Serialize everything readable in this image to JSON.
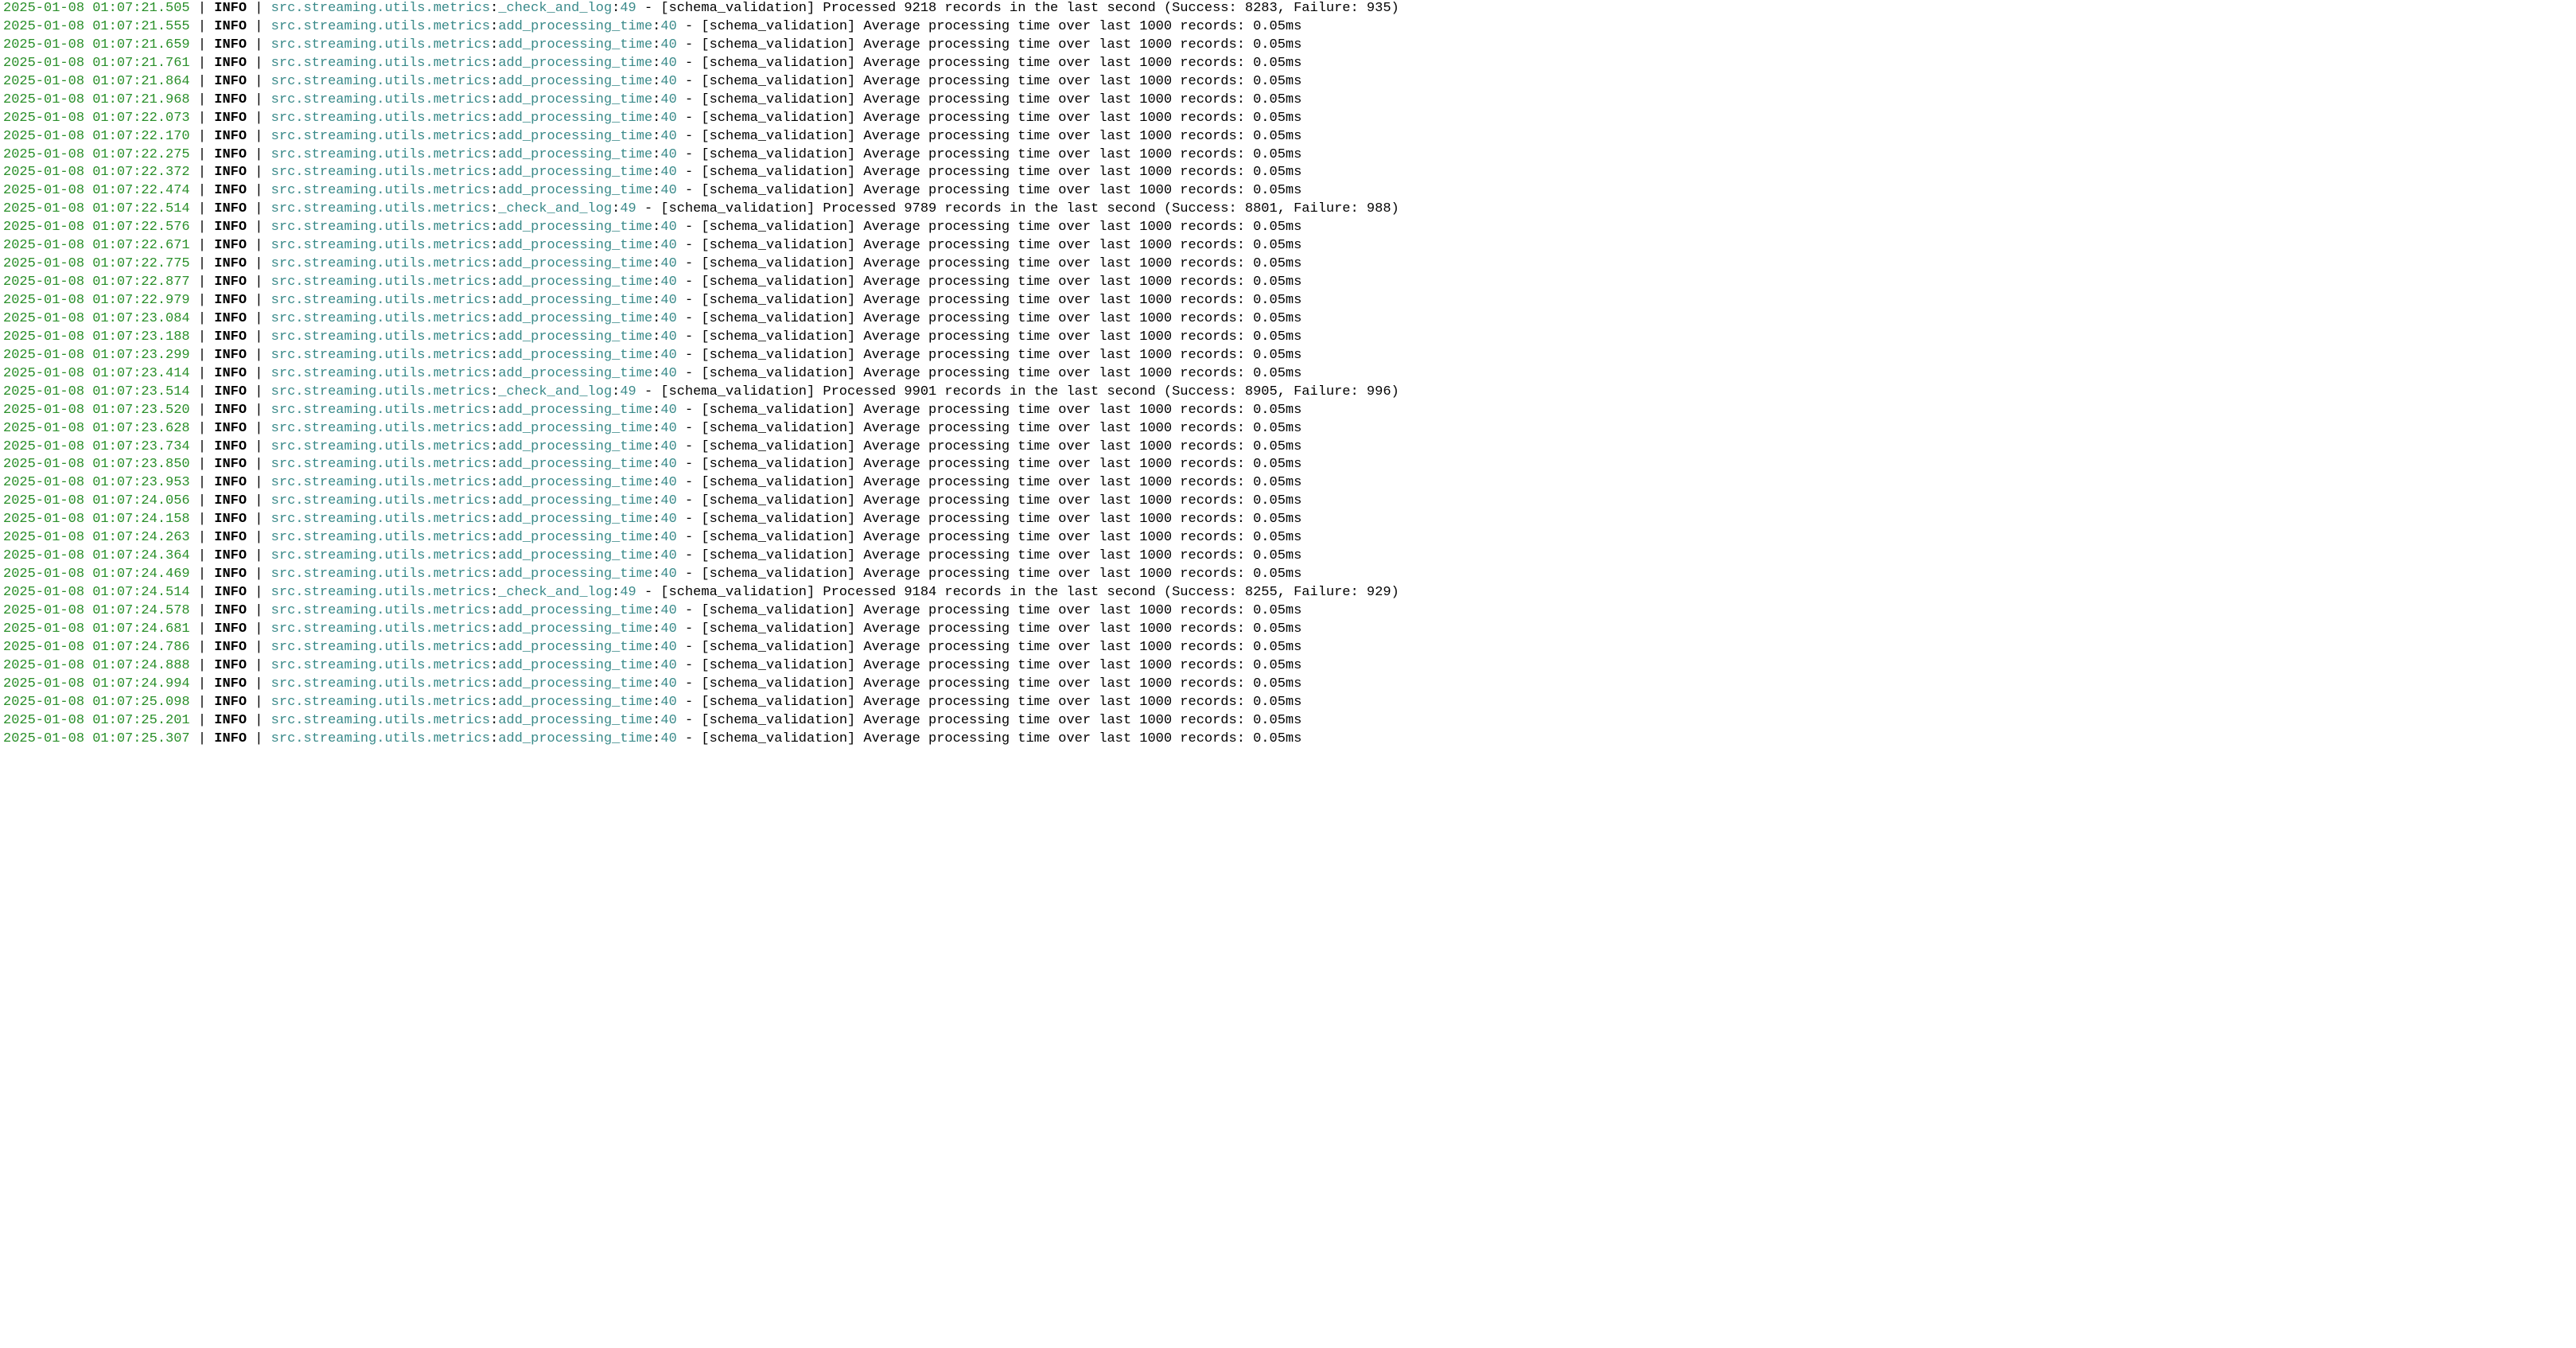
{
  "separator": " | ",
  "pipe": " | ",
  "level_pad": "    ",
  "module": "src.streaming.utils.metrics",
  "lines": [
    {
      "ts": "2025-01-08 01:07:21.505",
      "level": "INFO",
      "func": "_check_and_log",
      "lineno": "49",
      "msg": " - [schema_validation] Processed 9218 records in the last second (Success: 8283, Failure: 935)"
    },
    {
      "ts": "2025-01-08 01:07:21.555",
      "level": "INFO",
      "func": "add_processing_time",
      "lineno": "40",
      "msg": " - [schema_validation] Average processing time over last 1000 records: 0.05ms"
    },
    {
      "ts": "2025-01-08 01:07:21.659",
      "level": "INFO",
      "func": "add_processing_time",
      "lineno": "40",
      "msg": " - [schema_validation] Average processing time over last 1000 records: 0.05ms"
    },
    {
      "ts": "2025-01-08 01:07:21.761",
      "level": "INFO",
      "func": "add_processing_time",
      "lineno": "40",
      "msg": " - [schema_validation] Average processing time over last 1000 records: 0.05ms"
    },
    {
      "ts": "2025-01-08 01:07:21.864",
      "level": "INFO",
      "func": "add_processing_time",
      "lineno": "40",
      "msg": " - [schema_validation] Average processing time over last 1000 records: 0.05ms"
    },
    {
      "ts": "2025-01-08 01:07:21.968",
      "level": "INFO",
      "func": "add_processing_time",
      "lineno": "40",
      "msg": " - [schema_validation] Average processing time over last 1000 records: 0.05ms"
    },
    {
      "ts": "2025-01-08 01:07:22.073",
      "level": "INFO",
      "func": "add_processing_time",
      "lineno": "40",
      "msg": " - [schema_validation] Average processing time over last 1000 records: 0.05ms"
    },
    {
      "ts": "2025-01-08 01:07:22.170",
      "level": "INFO",
      "func": "add_processing_time",
      "lineno": "40",
      "msg": " - [schema_validation] Average processing time over last 1000 records: 0.05ms"
    },
    {
      "ts": "2025-01-08 01:07:22.275",
      "level": "INFO",
      "func": "add_processing_time",
      "lineno": "40",
      "msg": " - [schema_validation] Average processing time over last 1000 records: 0.05ms"
    },
    {
      "ts": "2025-01-08 01:07:22.372",
      "level": "INFO",
      "func": "add_processing_time",
      "lineno": "40",
      "msg": " - [schema_validation] Average processing time over last 1000 records: 0.05ms"
    },
    {
      "ts": "2025-01-08 01:07:22.474",
      "level": "INFO",
      "func": "add_processing_time",
      "lineno": "40",
      "msg": " - [schema_validation] Average processing time over last 1000 records: 0.05ms"
    },
    {
      "ts": "2025-01-08 01:07:22.514",
      "level": "INFO",
      "func": "_check_and_log",
      "lineno": "49",
      "msg": " - [schema_validation] Processed 9789 records in the last second (Success: 8801, Failure: 988)"
    },
    {
      "ts": "2025-01-08 01:07:22.576",
      "level": "INFO",
      "func": "add_processing_time",
      "lineno": "40",
      "msg": " - [schema_validation] Average processing time over last 1000 records: 0.05ms"
    },
    {
      "ts": "2025-01-08 01:07:22.671",
      "level": "INFO",
      "func": "add_processing_time",
      "lineno": "40",
      "msg": " - [schema_validation] Average processing time over last 1000 records: 0.05ms"
    },
    {
      "ts": "2025-01-08 01:07:22.775",
      "level": "INFO",
      "func": "add_processing_time",
      "lineno": "40",
      "msg": " - [schema_validation] Average processing time over last 1000 records: 0.05ms"
    },
    {
      "ts": "2025-01-08 01:07:22.877",
      "level": "INFO",
      "func": "add_processing_time",
      "lineno": "40",
      "msg": " - [schema_validation] Average processing time over last 1000 records: 0.05ms"
    },
    {
      "ts": "2025-01-08 01:07:22.979",
      "level": "INFO",
      "func": "add_processing_time",
      "lineno": "40",
      "msg": " - [schema_validation] Average processing time over last 1000 records: 0.05ms"
    },
    {
      "ts": "2025-01-08 01:07:23.084",
      "level": "INFO",
      "func": "add_processing_time",
      "lineno": "40",
      "msg": " - [schema_validation] Average processing time over last 1000 records: 0.05ms"
    },
    {
      "ts": "2025-01-08 01:07:23.188",
      "level": "INFO",
      "func": "add_processing_time",
      "lineno": "40",
      "msg": " - [schema_validation] Average processing time over last 1000 records: 0.05ms"
    },
    {
      "ts": "2025-01-08 01:07:23.299",
      "level": "INFO",
      "func": "add_processing_time",
      "lineno": "40",
      "msg": " - [schema_validation] Average processing time over last 1000 records: 0.05ms"
    },
    {
      "ts": "2025-01-08 01:07:23.414",
      "level": "INFO",
      "func": "add_processing_time",
      "lineno": "40",
      "msg": " - [schema_validation] Average processing time over last 1000 records: 0.05ms"
    },
    {
      "ts": "2025-01-08 01:07:23.514",
      "level": "INFO",
      "func": "_check_and_log",
      "lineno": "49",
      "msg": " - [schema_validation] Processed 9901 records in the last second (Success: 8905, Failure: 996)"
    },
    {
      "ts": "2025-01-08 01:07:23.520",
      "level": "INFO",
      "func": "add_processing_time",
      "lineno": "40",
      "msg": " - [schema_validation] Average processing time over last 1000 records: 0.05ms"
    },
    {
      "ts": "2025-01-08 01:07:23.628",
      "level": "INFO",
      "func": "add_processing_time",
      "lineno": "40",
      "msg": " - [schema_validation] Average processing time over last 1000 records: 0.05ms"
    },
    {
      "ts": "2025-01-08 01:07:23.734",
      "level": "INFO",
      "func": "add_processing_time",
      "lineno": "40",
      "msg": " - [schema_validation] Average processing time over last 1000 records: 0.05ms"
    },
    {
      "ts": "2025-01-08 01:07:23.850",
      "level": "INFO",
      "func": "add_processing_time",
      "lineno": "40",
      "msg": " - [schema_validation] Average processing time over last 1000 records: 0.05ms"
    },
    {
      "ts": "2025-01-08 01:07:23.953",
      "level": "INFO",
      "func": "add_processing_time",
      "lineno": "40",
      "msg": " - [schema_validation] Average processing time over last 1000 records: 0.05ms"
    },
    {
      "ts": "2025-01-08 01:07:24.056",
      "level": "INFO",
      "func": "add_processing_time",
      "lineno": "40",
      "msg": " - [schema_validation] Average processing time over last 1000 records: 0.05ms"
    },
    {
      "ts": "2025-01-08 01:07:24.158",
      "level": "INFO",
      "func": "add_processing_time",
      "lineno": "40",
      "msg": " - [schema_validation] Average processing time over last 1000 records: 0.05ms"
    },
    {
      "ts": "2025-01-08 01:07:24.263",
      "level": "INFO",
      "func": "add_processing_time",
      "lineno": "40",
      "msg": " - [schema_validation] Average processing time over last 1000 records: 0.05ms"
    },
    {
      "ts": "2025-01-08 01:07:24.364",
      "level": "INFO",
      "func": "add_processing_time",
      "lineno": "40",
      "msg": " - [schema_validation] Average processing time over last 1000 records: 0.05ms"
    },
    {
      "ts": "2025-01-08 01:07:24.469",
      "level": "INFO",
      "func": "add_processing_time",
      "lineno": "40",
      "msg": " - [schema_validation] Average processing time over last 1000 records: 0.05ms"
    },
    {
      "ts": "2025-01-08 01:07:24.514",
      "level": "INFO",
      "func": "_check_and_log",
      "lineno": "49",
      "msg": " - [schema_validation] Processed 9184 records in the last second (Success: 8255, Failure: 929)"
    },
    {
      "ts": "2025-01-08 01:07:24.578",
      "level": "INFO",
      "func": "add_processing_time",
      "lineno": "40",
      "msg": " - [schema_validation] Average processing time over last 1000 records: 0.05ms"
    },
    {
      "ts": "2025-01-08 01:07:24.681",
      "level": "INFO",
      "func": "add_processing_time",
      "lineno": "40",
      "msg": " - [schema_validation] Average processing time over last 1000 records: 0.05ms"
    },
    {
      "ts": "2025-01-08 01:07:24.786",
      "level": "INFO",
      "func": "add_processing_time",
      "lineno": "40",
      "msg": " - [schema_validation] Average processing time over last 1000 records: 0.05ms"
    },
    {
      "ts": "2025-01-08 01:07:24.888",
      "level": "INFO",
      "func": "add_processing_time",
      "lineno": "40",
      "msg": " - [schema_validation] Average processing time over last 1000 records: 0.05ms"
    },
    {
      "ts": "2025-01-08 01:07:24.994",
      "level": "INFO",
      "func": "add_processing_time",
      "lineno": "40",
      "msg": " - [schema_validation] Average processing time over last 1000 records: 0.05ms"
    },
    {
      "ts": "2025-01-08 01:07:25.098",
      "level": "INFO",
      "func": "add_processing_time",
      "lineno": "40",
      "msg": " - [schema_validation] Average processing time over last 1000 records: 0.05ms"
    },
    {
      "ts": "2025-01-08 01:07:25.201",
      "level": "INFO",
      "func": "add_processing_time",
      "lineno": "40",
      "msg": " - [schema_validation] Average processing time over last 1000 records: 0.05ms"
    },
    {
      "ts": "2025-01-08 01:07:25.307",
      "level": "INFO",
      "func": "add_processing_time",
      "lineno": "40",
      "msg": " - [schema_validation] Average processing time over last 1000 records: 0.05ms"
    }
  ]
}
